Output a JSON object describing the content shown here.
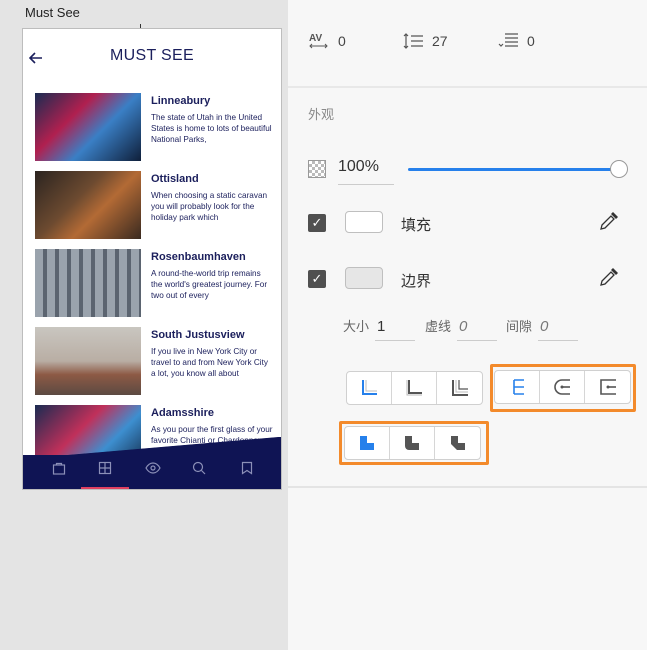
{
  "artboard": {
    "name": "Must See"
  },
  "app": {
    "title": "MUST SEE",
    "back_icon": "back-arrow-icon",
    "items": [
      {
        "title": "Linneabury",
        "body": "The state of Utah in the United States is home to lots of beautiful National Parks,"
      },
      {
        "title": "Ottisland",
        "body": "When choosing a static caravan you will probably look for the holiday park which"
      },
      {
        "title": "Rosenbaumhaven",
        "body": "A round-the-world trip remains the world's greatest journey. For two out of every"
      },
      {
        "title": "South Justusview",
        "body": "If you live in New York City or travel to and from New York City a lot, you know all about"
      },
      {
        "title": "Adamsshire",
        "body": "As you pour the first glass of your favorite Chianti or Chardonnay and settle into"
      }
    ],
    "tabs": [
      "bag-icon",
      "grid-icon",
      "eye-icon",
      "search-icon",
      "bookmark-icon"
    ],
    "active_tab_index": 1,
    "colors": {
      "navy": "#0f1454",
      "accent": "#e04060",
      "text": "#1b1f5c"
    }
  },
  "inspector": {
    "character_spacing": "0",
    "line_spacing": "27",
    "paragraph_spacing": "0",
    "appearance_label": "外观",
    "opacity": "100%",
    "opacity_fraction": 1.0,
    "fill": {
      "label": "填充",
      "checked": true,
      "color": "#ffffff"
    },
    "border": {
      "label": "边界",
      "checked": true,
      "color": "#e6e6e6"
    },
    "stroke": {
      "size_label": "大小",
      "size_value": "1",
      "dash_label": "虚线",
      "dash_value": "0",
      "gap_label": "间隙",
      "gap_value": "0"
    },
    "accent_color": "#2680eb",
    "highlight_color": "#f38a2b"
  }
}
